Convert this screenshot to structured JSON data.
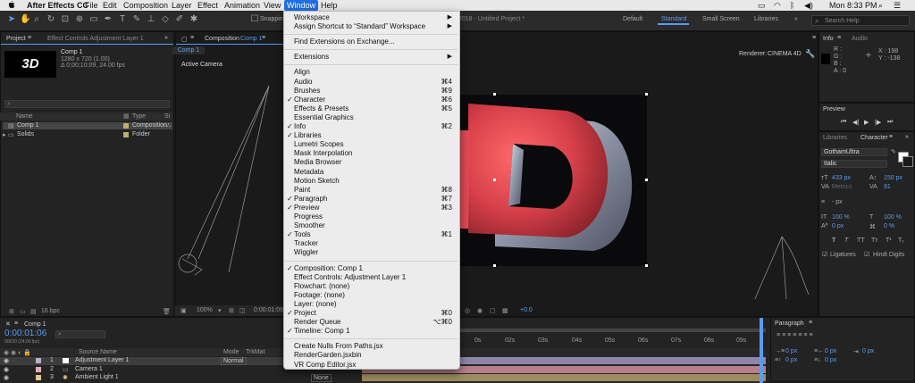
{
  "menubar": {
    "app": "After Effects CC",
    "items": [
      "File",
      "Edit",
      "Composition",
      "Layer",
      "Effect",
      "Animation",
      "View",
      "Window",
      "Help"
    ],
    "active": "Window",
    "clock": "Mon 8:33 PM"
  },
  "toolbar": {
    "snapping": "Snapping",
    "workspaces": [
      "Default",
      "Standard",
      "Small Screen",
      "Libraries"
    ],
    "active_workspace": "Standard",
    "search_placeholder": "Search Help",
    "title_fragment": "2018 - Untitled Project *"
  },
  "project_panel": {
    "tab": "Project",
    "effect_controls_tab": "Effect Controls Adjustment Layer 1",
    "thumb_text": "3D",
    "comp_name": "Comp 1",
    "comp_size": "1280 x 720 (1.00)",
    "comp_duration": "Δ 0;00;10;09, 24.00 fps",
    "col_name": "Name",
    "col_type": "Type",
    "col_size": "Si",
    "items": [
      {
        "name": "Comp 1",
        "type": "Composition"
      },
      {
        "name": "Solids",
        "type": "Folder"
      }
    ],
    "bpc": "16 bpc"
  },
  "composition_panel": {
    "tab": "Composition",
    "tab_comp": "Comp 1",
    "sub_tab": "Comp 1",
    "active_camera": "Active Camera",
    "renderer_label": "Renderer:",
    "renderer_value": "CINEMA 4D",
    "zoom": "100%",
    "timecode": "0:00:01:06",
    "exposure": "+0.0"
  },
  "window_menu": {
    "groups": [
      [
        {
          "label": "Workspace",
          "submenu": true
        },
        {
          "label": "Assign Shortcut to “Standard” Workspace",
          "submenu": true
        }
      ],
      [
        {
          "label": "Find Extensions on Exchange..."
        }
      ],
      [
        {
          "label": "Extensions",
          "submenu": true
        }
      ],
      [
        {
          "label": "Align"
        },
        {
          "label": "Audio",
          "shortcut": "⌘4"
        },
        {
          "label": "Brushes",
          "shortcut": "⌘9"
        },
        {
          "label": "Character",
          "checked": true,
          "shortcut": "⌘6"
        },
        {
          "label": "Effects & Presets",
          "shortcut": "⌘5"
        },
        {
          "label": "Essential Graphics"
        },
        {
          "label": "Info",
          "checked": true,
          "shortcut": "⌘2"
        },
        {
          "label": "Libraries",
          "checked": true
        },
        {
          "label": "Lumetri Scopes"
        },
        {
          "label": "Mask Interpolation"
        },
        {
          "label": "Media Browser"
        },
        {
          "label": "Metadata"
        },
        {
          "label": "Motion Sketch"
        },
        {
          "label": "Paint",
          "shortcut": "⌘8"
        },
        {
          "label": "Paragraph",
          "checked": true,
          "shortcut": "⌘7"
        },
        {
          "label": "Preview",
          "checked": true,
          "shortcut": "⌘3"
        },
        {
          "label": "Progress"
        },
        {
          "label": "Smoother"
        },
        {
          "label": "Tools",
          "checked": true,
          "shortcut": "⌘1"
        },
        {
          "label": "Tracker"
        },
        {
          "label": "Wiggler"
        }
      ],
      [
        {
          "label": "Composition: Comp 1",
          "checked": true
        },
        {
          "label": "Effect Controls: Adjustment Layer 1"
        },
        {
          "label": "Flowchart: (none)"
        },
        {
          "label": "Footage: (none)"
        },
        {
          "label": "Layer: (none)"
        },
        {
          "label": "Project",
          "checked": true,
          "shortcut": "⌘0"
        },
        {
          "label": "Render Queue",
          "shortcut": "⌥⌘0"
        },
        {
          "label": "Timeline: Comp 1",
          "checked": true
        }
      ],
      [
        {
          "label": "Create Nulls From Paths.jsx"
        },
        {
          "label": "RenderGarden.jsxbin"
        },
        {
          "label": "VR Comp Editor.jsx"
        }
      ]
    ]
  },
  "info_panel": {
    "tab": "Info",
    "audio_tab": "Audio",
    "r": "R :",
    "g": "G :",
    "b": "B :",
    "a": "A : 0",
    "x": "X : 198",
    "y": "Y : -138"
  },
  "preview_panel": {
    "tab": "Preview"
  },
  "character_panel": {
    "libraries_tab": "Libraries",
    "tab": "Character",
    "font": "GothamUltra",
    "style": "Italic",
    "size": "433 px",
    "leading": "150 px",
    "kerning": "Metrics",
    "tracking": "91",
    "stroke": "- px",
    "vscale": "100 %",
    "hscale": "100 %",
    "baseline": "0 px",
    "tsume": "0 %",
    "ligatures": "Ligatures",
    "hindi": "Hindi Digits"
  },
  "paragraph_panel": {
    "tab": "Paragraph",
    "values": [
      "0 px",
      "0 px",
      "0 px",
      "0 px",
      "0 px"
    ]
  },
  "timeline": {
    "tab": "Comp 1",
    "timecode": "0:00:01:06",
    "fps": "00030 (24.00 fps)",
    "col_source": "Source Name",
    "col_mode": "Mode",
    "col_trkmat": "TrkMat",
    "layers": [
      {
        "num": "1",
        "name": "Adjustment Layer 1",
        "mode": "Normal"
      },
      {
        "num": "2",
        "name": "Camera 1"
      },
      {
        "num": "3",
        "name": "Ambient Light 1",
        "mode": "None"
      }
    ],
    "ruler": [
      "0s",
      "02s",
      "03s",
      "04s",
      "05s",
      "06s",
      "07s",
      "08s",
      "09s",
      "10s"
    ]
  },
  "colors": {
    "accent": "#5a9cf0",
    "menu_bg": "#ececec",
    "highlight": "#1f6fe0",
    "extrusion": "#d8404a"
  }
}
